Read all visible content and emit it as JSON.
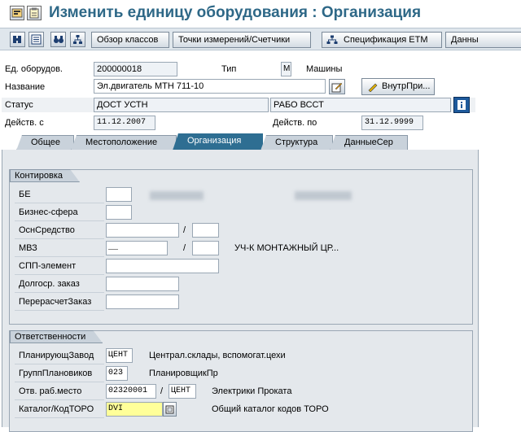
{
  "title": "Изменить единицу оборудования : Организация",
  "title_icons": [
    "sap-small-icon",
    "clipboard-icon"
  ],
  "toolbar": {
    "icons": [
      "equipment-icon",
      "list-icon",
      "binoculars-icon",
      "hierarchy-icon"
    ],
    "btn_classes": "Обзор классов",
    "btn_points": "Точки измерений/Счетчики",
    "btn_spec": "Спецификация ЕТМ",
    "btn_data": "Данны"
  },
  "header": {
    "equip_label": "Ед. оборудов.",
    "equip_value": "200000018",
    "type_label": "Тип",
    "type_value": "M",
    "type_desc": "Машины",
    "name_label": "Название",
    "name_value": "Эл.двигатель МТН 711-10",
    "internal_btn": "ВнутрПри...",
    "status_label": "Статус",
    "status_value": "ДОСТ УСТН",
    "status_value2": "РАБО ВССТ",
    "valid_from_label": "Действ. с",
    "valid_from_value": "11.12.2007",
    "valid_to_label": "Действ. по",
    "valid_to_value": "31.12.9999"
  },
  "tabs": [
    {
      "label": "Общее"
    },
    {
      "label": "Местоположение"
    },
    {
      "label": "Организация"
    },
    {
      "label": "Структура"
    },
    {
      "label": "ДанныеСер"
    }
  ],
  "kontirovka": {
    "title": "Контировка",
    "be_label": "БЕ",
    "sphere_label": "Бизнес-сфера",
    "asset_label": "ОснСредство",
    "mvz_label": "МВЗ",
    "mvz_value": "__",
    "mvz_desc": "УЧ-К МОНТАЖНЫЙ ЦР...",
    "wbs_label": "СПП-элемент",
    "longterm_label": "Долгоср. заказ",
    "settlement_label": "ПерерасчетЗаказ",
    "slash": "/"
  },
  "responsibility": {
    "title": "Ответственности",
    "plant_label": "ПланирующЗавод",
    "plant_value": "ЦЕНТ",
    "plant_desc": "Централ.склады, вспомогат.цехи",
    "group_label": "ГруппПлановиков",
    "group_value": "023",
    "group_desc": "ПланировщикПр",
    "workcenter_label": "Отв. раб.место",
    "workcenter_value": "02320001",
    "workcenter_value2": "ЦЕНТ",
    "workcenter_desc": "Электрики Проката",
    "catalog_label": "Каталог/КодТОРО",
    "catalog_value": "DVI",
    "catalog_desc": "Общий каталог кодов ТОРО",
    "slash": "/"
  },
  "colors": {
    "title": "#2e6887",
    "active_tab": "#2e6e92",
    "panel": "#e4e8ec",
    "toolbar": "#dfe6ec"
  }
}
